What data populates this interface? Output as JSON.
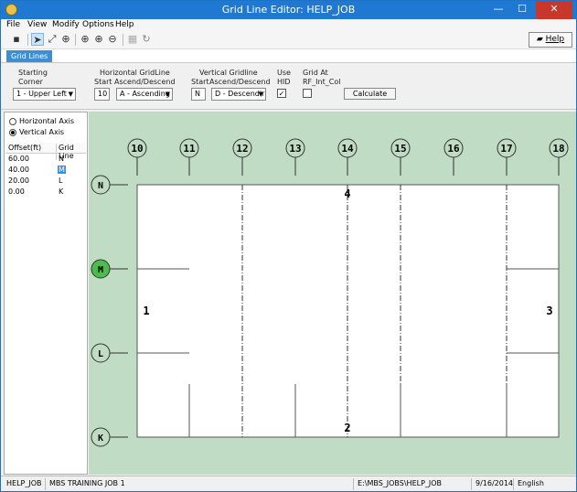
{
  "window": {
    "title": "Grid Line Editor: HELP_JOB",
    "minimize": "—",
    "maximize": "☐",
    "close": "✕"
  },
  "menu": {
    "file": "File",
    "view": "View",
    "modify": "Modify",
    "options": "Options",
    "help": "Help"
  },
  "toolbar": {
    "help_label": "Help"
  },
  "tab": {
    "label": "Grid Lines"
  },
  "panel": {
    "starting_label_1": "Starting",
    "starting_label_2": "Corner",
    "corner_value": "1 - Upper Left",
    "horiz_label": "Horizontal GridLine",
    "horiz_start_label": "Start",
    "horiz_asc_label": "Ascend/Descend",
    "horiz_start_value": "10",
    "horiz_asc_value": "A - Ascending",
    "vert_label": "Vertical Gridline",
    "vert_start_label": "Start",
    "vert_asc_label": "Ascend/Descend",
    "vert_start_value": "N",
    "vert_asc_value": "D - Descendir",
    "use_label_1": "Use",
    "use_label_2": "HID",
    "use_hid_checked": true,
    "gridat_label_1": "Grid At",
    "gridat_label_2": "RF_Int_Col",
    "gridat_checked": false,
    "calculate_label": "Calculate"
  },
  "left": {
    "radio_horizontal": "Horizontal Axis",
    "radio_vertical": "Vertical Axis",
    "selected_axis": "vertical",
    "col_offset": "Offset(ft)",
    "col_gridline": "Grid Line",
    "rows": [
      {
        "offset": "60.00",
        "grid": "N"
      },
      {
        "offset": "40.00",
        "grid": "M"
      },
      {
        "offset": "20.00",
        "grid": "L"
      },
      {
        "offset": "0.00",
        "grid": "K"
      }
    ],
    "selected_row": 1
  },
  "canvas": {
    "colors": {
      "background": "#c1dcc4",
      "building": "#ffffff",
      "selected_bubble": "#4cbc4c"
    },
    "vertical_bubbles": [
      "10",
      "11",
      "12",
      "13",
      "14",
      "15",
      "16",
      "17",
      "18"
    ],
    "horizontal_bubbles": [
      "N",
      "M",
      "L",
      "K"
    ],
    "selected_bubble": "M",
    "wall_labels": {
      "top": "4",
      "bottom": "2",
      "left": "1",
      "right": "3"
    }
  },
  "status": {
    "job": "HELP_JOB",
    "desc": "MBS TRAINING JOB 1",
    "path": "E:\\MBS_JOBS\\HELP_JOB",
    "date": "9/16/2014",
    "lang": "English"
  }
}
